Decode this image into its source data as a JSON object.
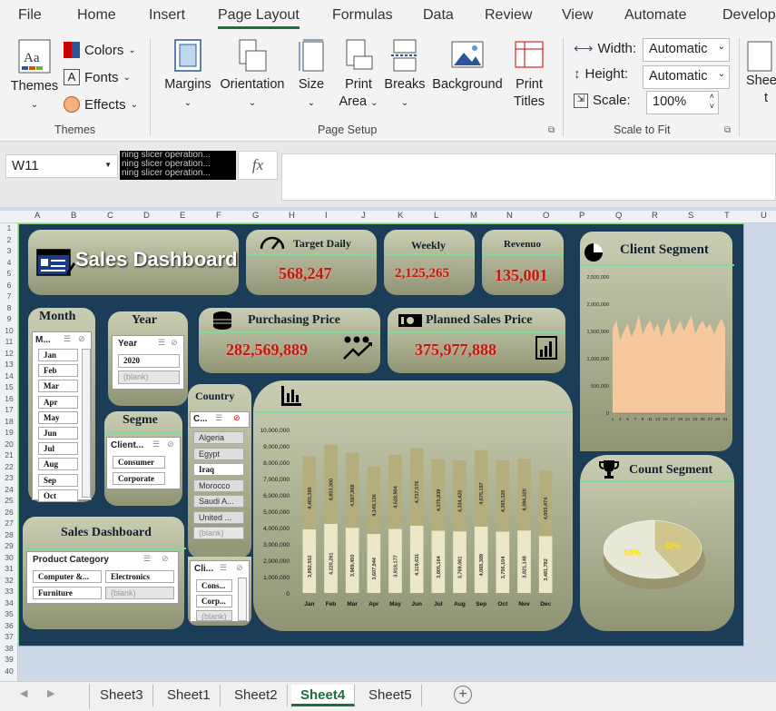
{
  "menu_tabs": [
    "File",
    "Home",
    "Insert",
    "Page Layout",
    "Formulas",
    "Data",
    "Review",
    "View",
    "Automate",
    "Develop"
  ],
  "active_tab": "Page Layout",
  "ribbon": {
    "themes": {
      "themes": "Themes",
      "colors": "Colors",
      "fonts": "Fonts",
      "effects": "Effects",
      "group": "Themes"
    },
    "page_setup": {
      "margins": "Margins",
      "orientation": "Orientation",
      "size": "Size",
      "print_area_1": "Print",
      "print_area_2": "Area",
      "breaks": "Breaks",
      "background": "Background",
      "print_titles_1": "Print",
      "print_titles_2": "Titles",
      "group": "Page Setup"
    },
    "scale_to_fit": {
      "width_label": "Width:",
      "width_value": "Automatic",
      "height_label": "Height:",
      "height_value": "Automatic",
      "scale_label": "Scale:",
      "scale_value": "100%",
      "group": "Scale to Fit"
    },
    "sheet_options_partial": "Shee",
    "sheet_options_partial2": "t"
  },
  "formula_bar": {
    "name_box": "W11",
    "fx": "fx",
    "tooltip_lines": [
      "ning slicer operation...",
      "ning slicer operation...",
      "ning slicer operation..."
    ]
  },
  "columns": [
    "A",
    "B",
    "C",
    "D",
    "E",
    "F",
    "G",
    "H",
    "I",
    "J",
    "K",
    "L",
    "M",
    "N",
    "O",
    "P",
    "Q",
    "R",
    "S",
    "T",
    "U"
  ],
  "rows": [
    "1",
    "2",
    "3",
    "4",
    "5",
    "6",
    "7",
    "8",
    "9",
    "10",
    "11",
    "12",
    "13",
    "14",
    "15",
    "16",
    "17",
    "18",
    "19",
    "20",
    "21",
    "22",
    "23",
    "24",
    "25",
    "26",
    "27",
    "28",
    "29",
    "30",
    "31",
    "32",
    "33",
    "34",
    "35",
    "36",
    "37",
    "38",
    "39",
    "40"
  ],
  "dashboard": {
    "title": "Sales Dashboard",
    "target_daily": {
      "label": "Target Daily",
      "value": "568,247"
    },
    "weekly": {
      "label": "Weekly",
      "value": "2,125,265"
    },
    "revenue": {
      "label": "Revenuo",
      "value": "135,001"
    },
    "purchasing": {
      "label": "Purchasing Price",
      "value": "282,569,889"
    },
    "planned": {
      "label": "Planned Sales Price",
      "value": "375,977,888"
    },
    "client_segment": {
      "label": "Client Segment"
    },
    "count_segment": {
      "label": "Count Segment"
    },
    "sales_dashboard2": "Sales Dashboard",
    "month_slicer": {
      "title": "Month",
      "header": "M...",
      "items": [
        "Jan",
        "Feb",
        "Mar",
        "Apr",
        "May",
        "Jun",
        "Jul",
        "Aug",
        "Sep",
        "Oct"
      ]
    },
    "year_slicer": {
      "title": "Year",
      "header": "Year",
      "items": [
        "2020",
        "(blank)"
      ]
    },
    "segment_slicer": {
      "title": "Segme",
      "header": "Client...",
      "items": [
        "Consumer",
        "Corporate"
      ]
    },
    "country_slicer": {
      "title": "Country",
      "header": "C...",
      "items": [
        "Algeria",
        "Egypt",
        "Iraq",
        "Morocco",
        "Saudi A...",
        "United ...",
        "(blank)"
      ]
    },
    "client_slicer": {
      "header": "Cli...",
      "items": [
        "Cons...",
        "Corp...",
        "(blank)"
      ]
    },
    "category_slicer": {
      "header": "Product Category",
      "items": [
        "Computer &...",
        "Electronics",
        "Furniture",
        "(blank)"
      ]
    }
  },
  "chart_data": [
    {
      "type": "bar",
      "title": "",
      "categories": [
        "Jan",
        "Feb",
        "Mar",
        "Apr",
        "May",
        "Jun",
        "Jul",
        "Aug",
        "Sep",
        "Oct",
        "Nov",
        "Dec"
      ],
      "series": [
        {
          "name": "",
          "values": [
            3892552,
            4220261,
            3989450,
            3607944,
            3918177,
            4119631,
            3805164,
            3769061,
            4065389,
            3756104,
            3821148,
            3481782
          ]
        },
        {
          "name": "",
          "values": [
            4465395,
            4853300,
            4587868,
            4149136,
            4528904,
            4737576,
            4375939,
            4334420,
            4675197,
            4365320,
            4394320,
            4003474
          ]
        }
      ],
      "y_ticks": [
        "0",
        "1,000,000",
        "2,000,000",
        "3,000,000",
        "4,000,000",
        "5,000,000",
        "6,000,000",
        "7,000,000",
        "8,000,000",
        "9,000,000",
        "10,000,000"
      ],
      "ylim": [
        0,
        10000000
      ],
      "colors": [
        "#ece7c8",
        "#b6ad7c"
      ]
    },
    {
      "type": "area",
      "title": "Client Segment",
      "x": [
        "1",
        "3",
        "5",
        "7",
        "9",
        "11",
        "13",
        "15",
        "17",
        "19",
        "21",
        "23",
        "25",
        "27",
        "29",
        "31"
      ],
      "values": [
        1550000,
        1700000,
        1350000,
        1500000,
        1650000,
        1400000,
        1550000,
        1800000,
        1450000,
        1600000,
        1700000,
        1500000,
        1650000,
        1400000,
        1600000,
        1750000,
        1450000,
        1550000,
        1700000,
        1500000,
        1650000,
        1800000,
        1450000,
        1600000,
        1700000,
        1550000,
        1650000,
        1450000,
        1600000,
        1750000,
        1550000
      ],
      "y_ticks": [
        "0",
        "500,000",
        "1,000,000",
        "1,500,000",
        "2,000,000",
        "2,500,000"
      ],
      "ylim": [
        0,
        2500000
      ],
      "color": "#f6c89b"
    },
    {
      "type": "pie",
      "title": "Count Segment",
      "labels": [
        "42%",
        "58%"
      ],
      "values": [
        42,
        58
      ],
      "colors": [
        "#cfc68e",
        "#e8e8d8"
      ]
    }
  ],
  "sheet_tabs": [
    "Sheet3",
    "Sheet1",
    "Sheet2",
    "Sheet4",
    "Sheet5"
  ],
  "active_sheet": "Sheet4"
}
